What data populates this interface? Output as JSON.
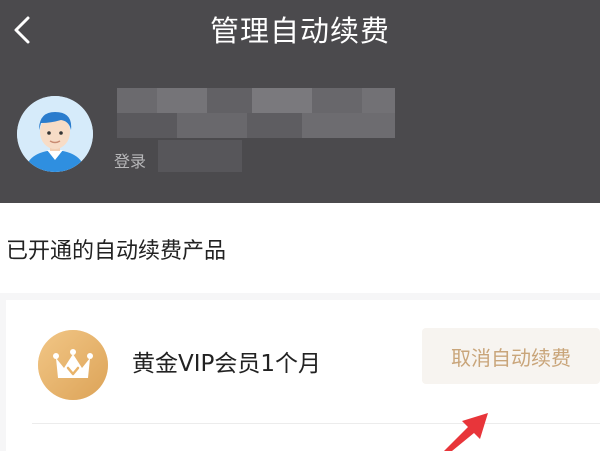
{
  "header": {
    "title": "管理自动续费",
    "back_icon": "chevron-left-icon"
  },
  "user": {
    "avatar_icon": "user-avatar-icon",
    "login_label": "登录"
  },
  "section": {
    "title": "已开通的自动续费产品"
  },
  "product": {
    "icon": "crown-badge-icon",
    "name": "黄金VIP会员1个月",
    "cancel_label": "取消自动续费"
  },
  "colors": {
    "header_bg": "#4b4a4d",
    "accent_gold": "#e9b46a",
    "cancel_text": "#c9a57a",
    "annotation_arrow": "#e8353a"
  }
}
